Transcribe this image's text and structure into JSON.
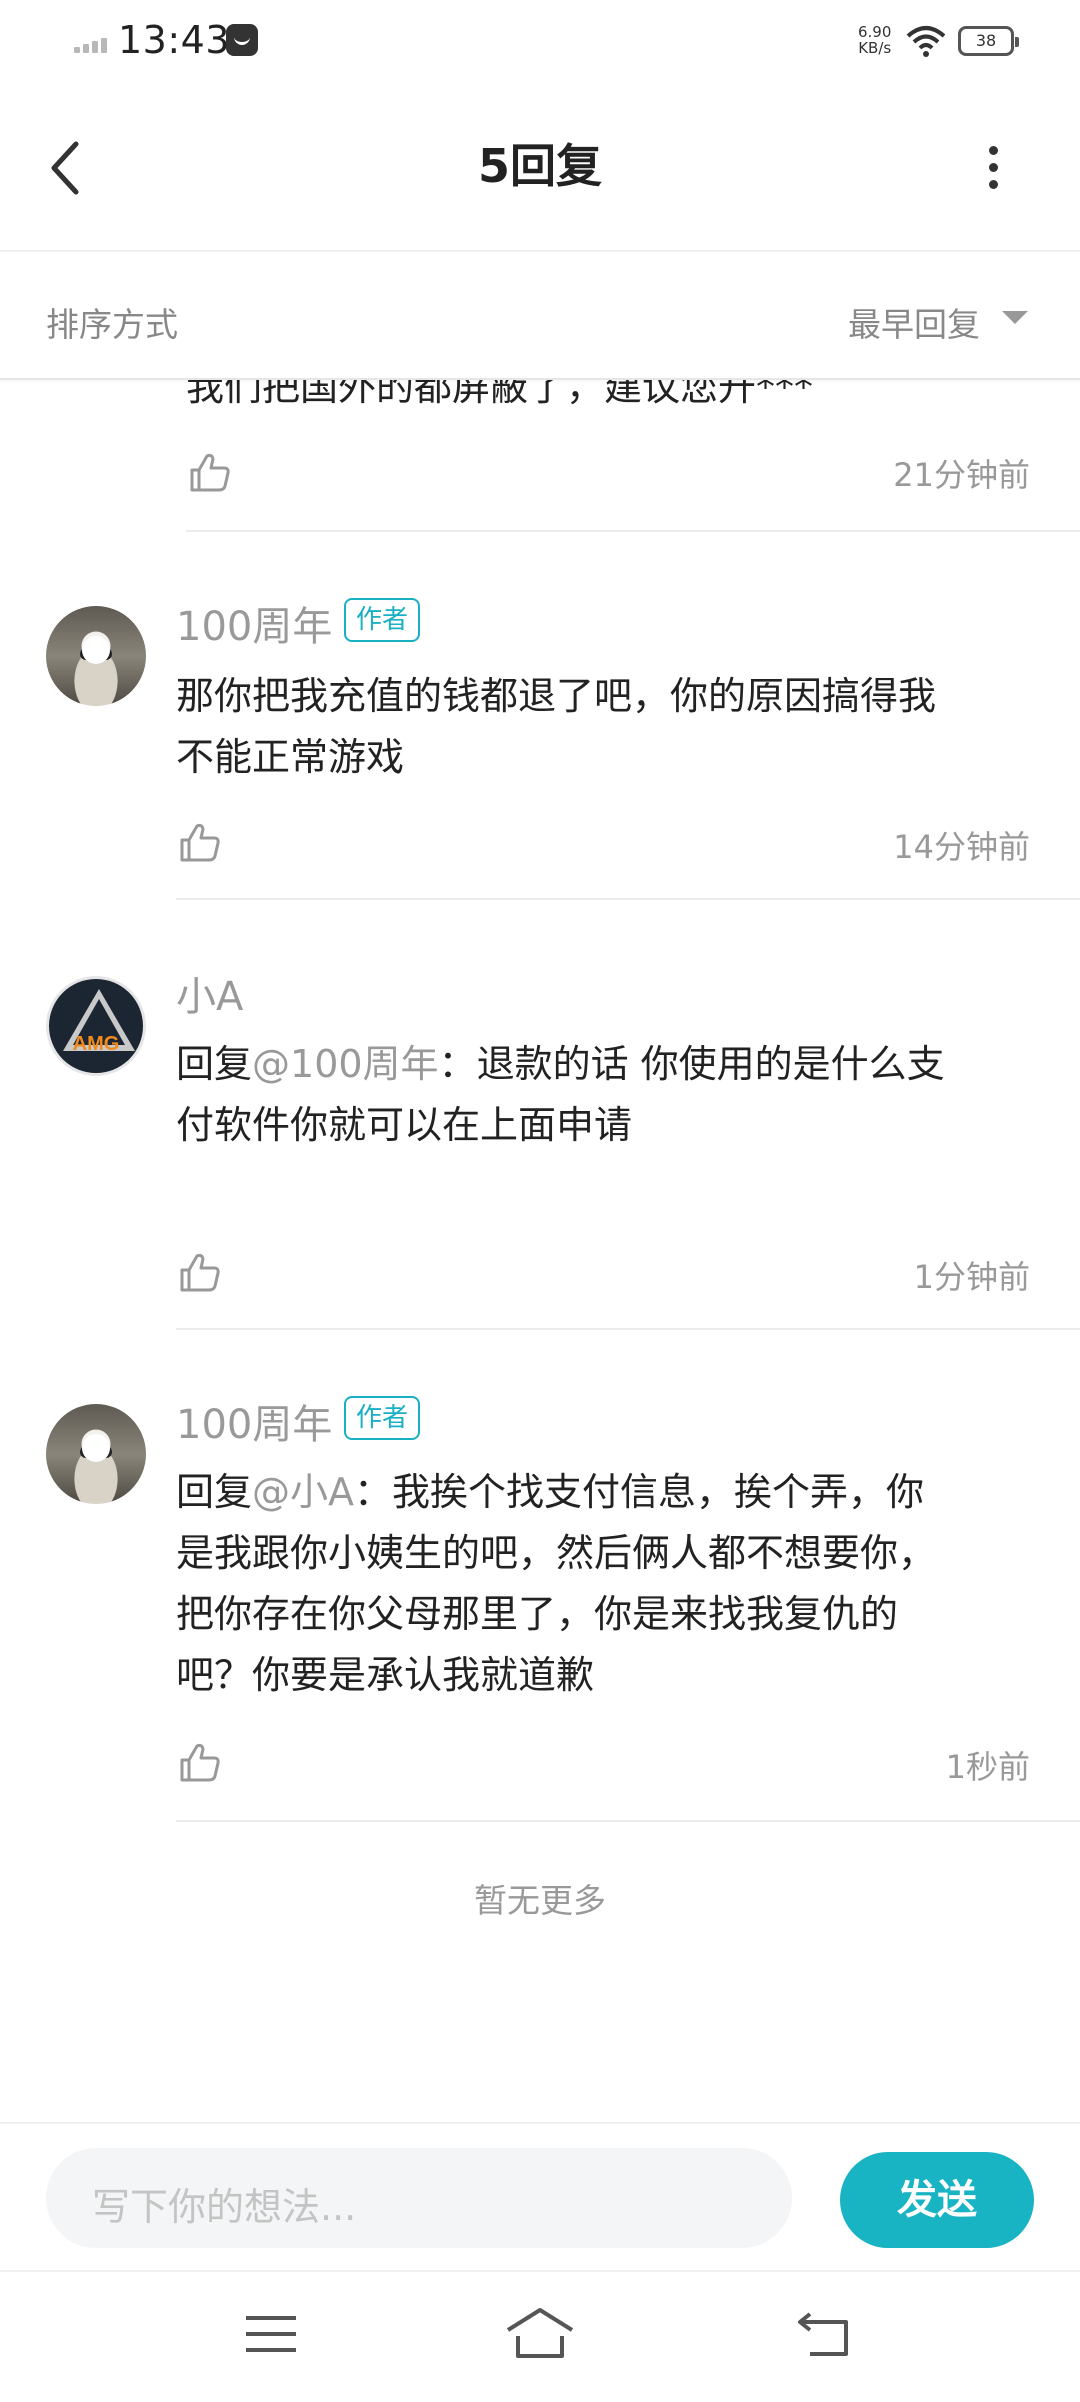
{
  "status_bar": {
    "time": "13:43",
    "speed_value": "6.90",
    "speed_unit": "KB/s",
    "battery": "38"
  },
  "header": {
    "title": "5回复"
  },
  "sort": {
    "label": "排序方式",
    "value": "最早回复"
  },
  "comments": {
    "partial": {
      "text": "我们把国外的都屏蔽了，建议您升***",
      "time": "21分钟前"
    },
    "items": [
      {
        "name": "100周年",
        "badge": "作者",
        "text_lines": [
          "那你把我充值的钱都退了吧，你的原因搞得我",
          "不能正常游戏"
        ],
        "time": "14分钟前"
      },
      {
        "name": "小A",
        "reply_prefix": "回复",
        "mention": "@100周年",
        "colon": "：",
        "line1_rest": "退款的话 你使用的是什么支",
        "line2": "付软件你就可以在上面申请",
        "avatar_text": "AMG",
        "time": "1分钟前"
      },
      {
        "name": "100周年",
        "badge": "作者",
        "reply_prefix": "回复",
        "mention": "@小A",
        "colon": "：",
        "line1_rest": "我挨个找支付信息，挨个弄，你",
        "lines": [
          "是我跟你小姨生的吧，然后俩人都不想要你，",
          "把你存在你父母那里了，你是来找我复仇的",
          "吧？你要是承认我就道歉"
        ],
        "time": "1秒前"
      }
    ]
  },
  "footer": {
    "no_more": "暂无更多"
  },
  "input": {
    "placeholder": "写下你的想法...",
    "send_label": "发送"
  }
}
